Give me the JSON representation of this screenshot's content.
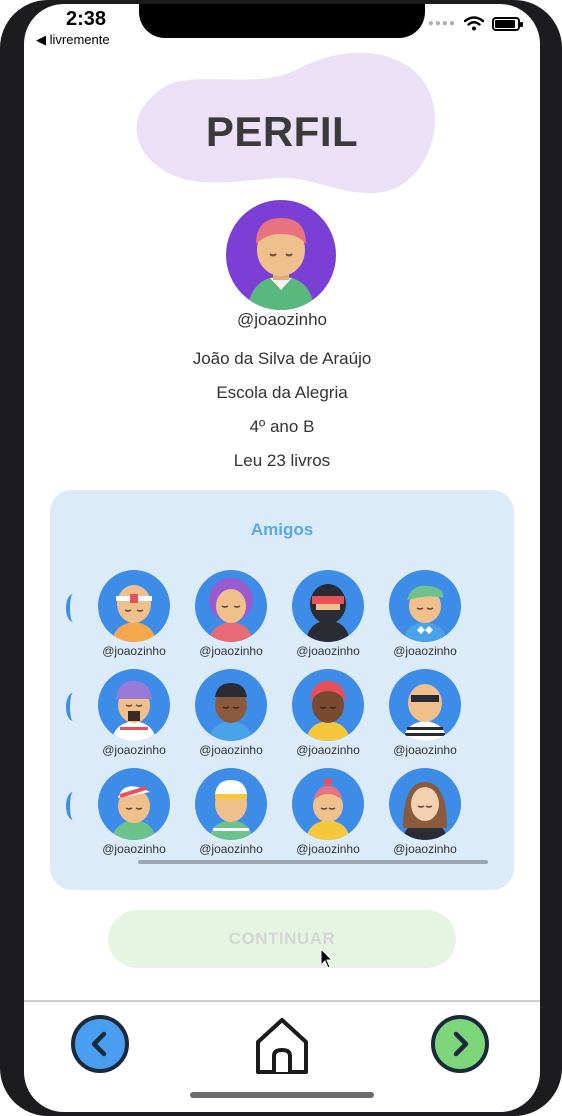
{
  "status_bar": {
    "time": "2:38",
    "back_app": "◀ livremente"
  },
  "page": {
    "title": "PERFIL"
  },
  "profile": {
    "handle": "@joaozinho",
    "name": "João da Silva de Araújo",
    "school": "Escola da Alegria",
    "grade": "4º ano B",
    "books_read": "Leu 23 livros"
  },
  "friends": {
    "title": "Amigos",
    "rows": [
      [
        {
          "handle": "@joaozinho"
        },
        {
          "handle": "@joaozinho"
        },
        {
          "handle": "@joaozinho"
        },
        {
          "handle": "@joaozinho"
        }
      ],
      [
        {
          "handle": "@joaozinho"
        },
        {
          "handle": "@joaozinho"
        },
        {
          "handle": "@joaozinho"
        },
        {
          "handle": "@joaozinho"
        }
      ],
      [
        {
          "handle": "@joaozinho"
        },
        {
          "handle": "@joaozinho"
        },
        {
          "handle": "@joaozinho"
        },
        {
          "handle": "@joaozinho"
        }
      ]
    ]
  },
  "actions": {
    "continue_label": "CONTINUAR"
  },
  "bottom_nav": {
    "prev_icon": "chevron-left-circle-icon",
    "home_icon": "home-icon",
    "next_icon": "chevron-right-circle-icon"
  },
  "colors": {
    "accent_blue": "#57a9e8",
    "panel_bg": "#dcebfa",
    "avatar_bg": "#3d8de8",
    "profile_avatar_bg": "#7b3fd6",
    "blob": "#ebe0f6",
    "continue_bg": "#e6f5e2",
    "nav_prev": "#4a9ef0",
    "nav_next": "#7ed67a"
  }
}
